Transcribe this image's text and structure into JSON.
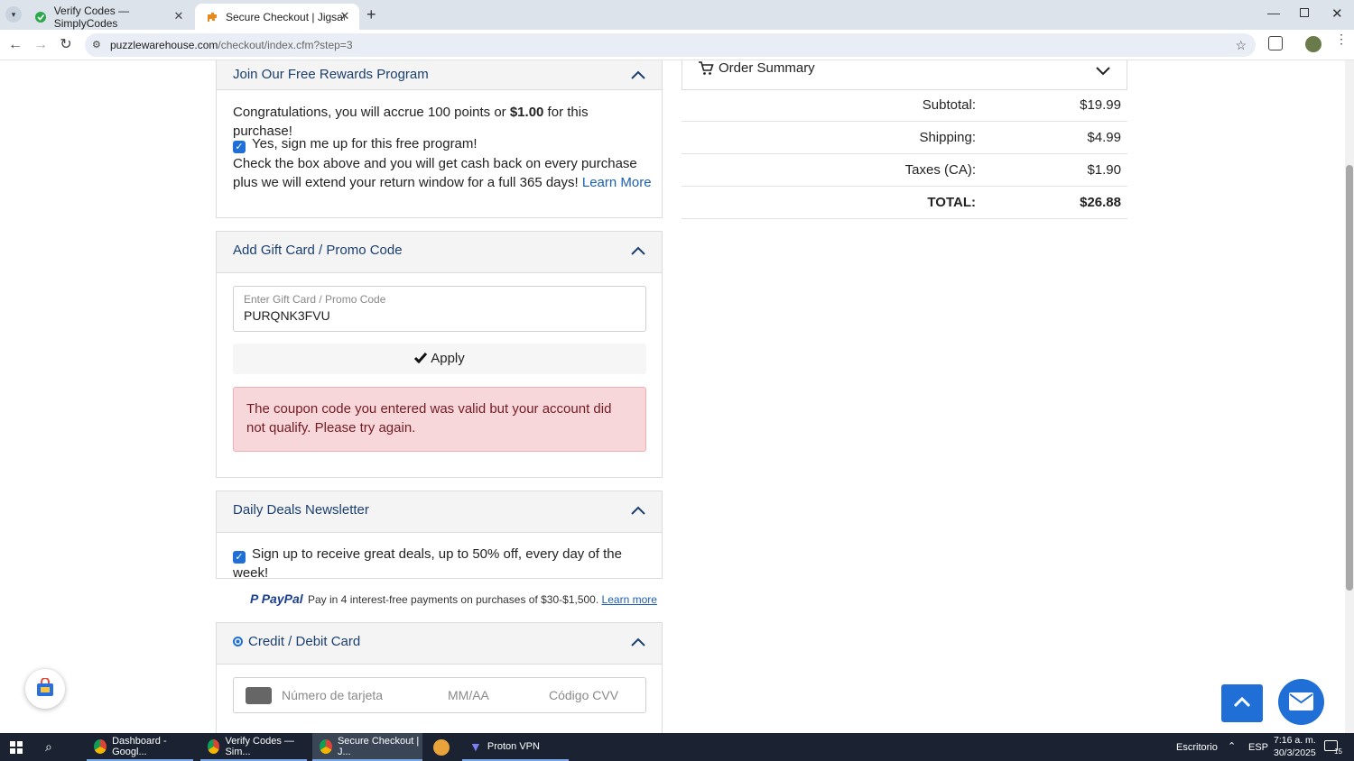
{
  "browser": {
    "tabs": [
      {
        "title": "Verify Codes — SimplyCodes",
        "icon": "simplycodes-icon"
      },
      {
        "title": "Secure Checkout | Jigsaw Puzzl",
        "icon": "puzzlewarehouse-icon"
      }
    ],
    "url_domain": "puzzlewarehouse.com",
    "url_path": "/checkout/index.cfm?step=3"
  },
  "rewards": {
    "title": "Join Our Free Rewards Program",
    "congrats_prefix": "Congratulations, you will accrue 100 points or ",
    "congrats_amount": "$1.00",
    "congrats_suffix": " for this purchase!",
    "checkbox_label": "Yes, sign me up for this free program!",
    "description": "Check the box above and you will get cash back on every purchase plus we will extend your return window for a full 365 days! ",
    "learn_more": "Learn More"
  },
  "promo": {
    "title": "Add Gift Card / Promo Code",
    "field_label": "Enter Gift Card / Promo Code",
    "field_value": "PURQNK3FVU",
    "apply_label": "Apply",
    "error": "The coupon code you entered was valid but your account did not qualify. Please try again."
  },
  "newsletter": {
    "title": "Daily Deals Newsletter",
    "checkbox_label": "Sign up to receive great deals, up to 50% off, every day of the week!"
  },
  "paypal": {
    "brand": "PayPal",
    "text": "Pay in 4 interest-free payments on purchases of $30-$1,500.",
    "learn_more": "Learn more"
  },
  "payment": {
    "title": "Credit / Debit Card",
    "card_number_placeholder": "Número de tarjeta",
    "expiry_placeholder": "MM/AA",
    "cvv_placeholder": "Código CVV"
  },
  "summary": {
    "title": "Order Summary",
    "rows": [
      {
        "label": "Subtotal:",
        "value": "$19.99"
      },
      {
        "label": "Shipping:",
        "value": "$4.99"
      },
      {
        "label": "Taxes (CA):",
        "value": "$1.90"
      },
      {
        "label": "TOTAL:",
        "value": "$26.88"
      }
    ]
  },
  "taskbar": {
    "items": [
      "Dashboard - Googl...",
      "Verify Codes — Sim...",
      "Secure Checkout | J...",
      "Proton VPN"
    ],
    "desktop_label": "Escritorio",
    "lang": "ESP",
    "time": "7:16 a. m.",
    "date": "30/3/2025",
    "notification_count": "15"
  },
  "colors": {
    "accent": "#1f6fd6",
    "heading": "#1b3f6f",
    "error_bg": "#f8d7da",
    "error_text": "#721c24",
    "fab": "#1f6fd6"
  }
}
